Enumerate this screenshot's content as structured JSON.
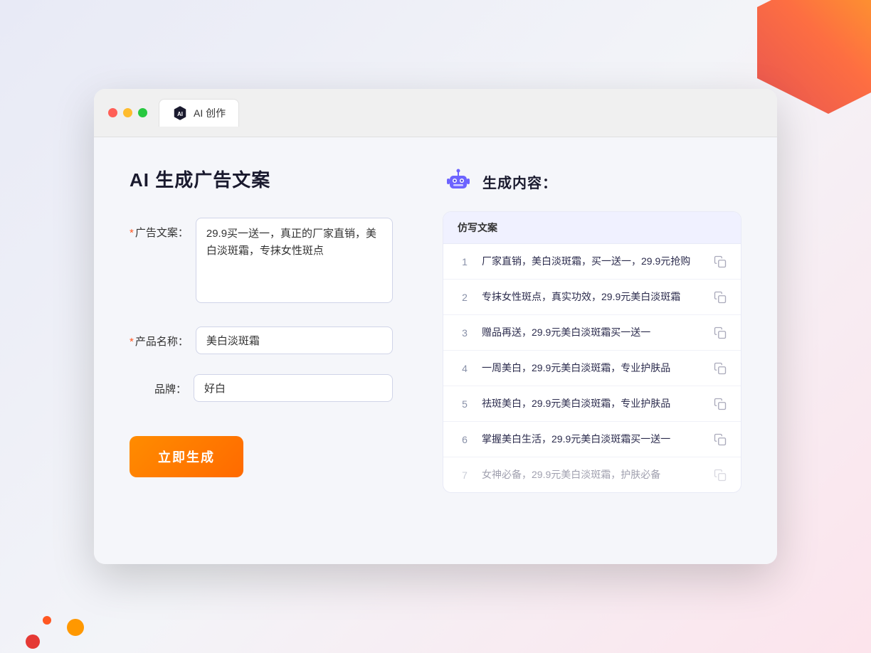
{
  "browser": {
    "tab_label": "AI 创作",
    "dot_red": "close",
    "dot_yellow": "minimize",
    "dot_green": "maximize"
  },
  "left": {
    "page_title": "AI 生成广告文案",
    "ad_copy_label": "广告文案：",
    "ad_copy_required": "*",
    "ad_copy_value": "29.9买一送一，真正的厂家直销，美白淡斑霜，专抹女性斑点",
    "product_name_label": "产品名称：",
    "product_name_required": "*",
    "product_name_value": "美白淡斑霜",
    "brand_label": "品牌：",
    "brand_value": "好白",
    "submit_label": "立即生成"
  },
  "right": {
    "result_title": "生成内容：",
    "column_header": "仿写文案",
    "results": [
      {
        "id": 1,
        "text": "厂家直销，美白淡斑霜，买一送一，29.9元抢购"
      },
      {
        "id": 2,
        "text": "专抹女性斑点，真实功效，29.9元美白淡斑霜"
      },
      {
        "id": 3,
        "text": "赠品再送，29.9元美白淡斑霜买一送一"
      },
      {
        "id": 4,
        "text": "一周美白，29.9元美白淡斑霜，专业护肤品"
      },
      {
        "id": 5,
        "text": "祛斑美白，29.9元美白淡斑霜，专业护肤品"
      },
      {
        "id": 6,
        "text": "掌握美白生活，29.9元美白淡斑霜买一送一"
      },
      {
        "id": 7,
        "text": "女神必备，29.9元美白淡斑霜，护肤必备",
        "faded": true
      }
    ]
  }
}
